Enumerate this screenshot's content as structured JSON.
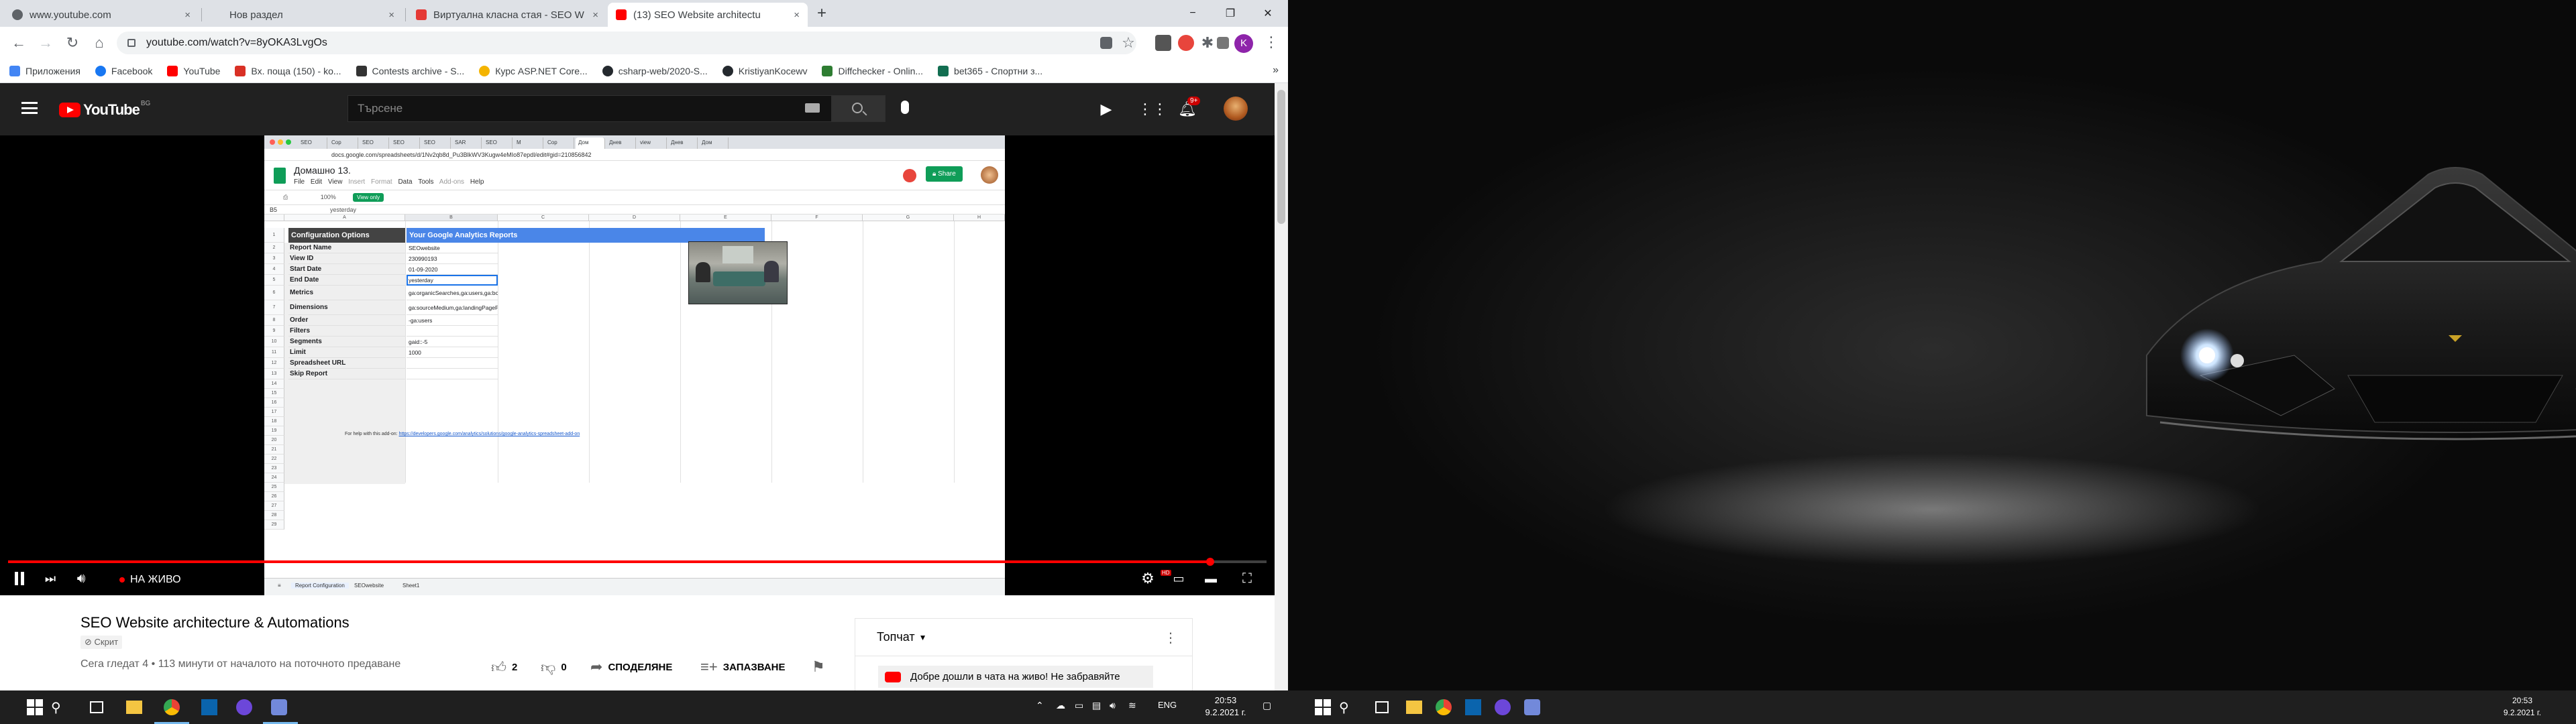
{
  "browser": {
    "tabs": [
      {
        "label": "www.youtube.com",
        "favicon_color": "#5f6368",
        "active": false
      },
      {
        "label": "Нов раздел",
        "favicon_color": "#dee1e6",
        "active": false
      },
      {
        "label": "Виртуална класна стая - SEO W",
        "favicon_color": "#e53935",
        "active": false
      },
      {
        "label": "(13) SEO Website architectu",
        "favicon_color": "#ff0000",
        "active": true
      }
    ],
    "close_glyph": "×",
    "new_tab_glyph": "+",
    "window_controls": {
      "minimize": "−",
      "maximize": "❐",
      "close": "✕"
    },
    "url": "youtube.com/watch?v=8yOKA3LvgOs",
    "profile_initial": "K"
  },
  "bookmarks": [
    {
      "label": "Приложения",
      "color": "#4285f4"
    },
    {
      "label": "Facebook",
      "color": "#1877f2"
    },
    {
      "label": "YouTube",
      "color": "#ff0000"
    },
    {
      "label": "Вх. поща (150) - ko...",
      "color": "#d93025"
    },
    {
      "label": "Contests archive - S...",
      "color": "#333333"
    },
    {
      "label": "Курс ASP.NET Core...",
      "color": "#f4b400"
    },
    {
      "label": "csharp-web/2020-S...",
      "color": "#24292e"
    },
    {
      "label": "KristiyanKocewv",
      "color": "#24292e"
    },
    {
      "label": "Diffchecker - Onlin...",
      "color": "#2e7d32"
    },
    {
      "label": "bet365 - Спортни з...",
      "color": "#126e51"
    }
  ],
  "bookmarks_more": "»",
  "youtube": {
    "logo_text": "YouTube",
    "country": "BG",
    "search_placeholder": "Търсене",
    "notification_count": "9+"
  },
  "player": {
    "live_label": "НА ЖИВО",
    "progress": 0.955,
    "spreadsheet": {
      "browser_tabs": [
        "SEO",
        "Сор",
        "SEO",
        "SEO",
        "SEO",
        "SAR",
        "SEO",
        "M",
        "Сор",
        "Дом",
        "Днев",
        "view",
        "Днев",
        "Дом"
      ],
      "url": "docs.google.com/spreadsheets/d/1Nv2qb8d_Pu3BlkWV3Kugw4eMIo87epdl/edit#gid=210856842",
      "doc_title": "Домашно 13.",
      "menu": [
        "File",
        "Edit",
        "View",
        "Insert",
        "Format",
        "Data",
        "Tools",
        "Add-ons",
        "Help"
      ],
      "share_label": "Share",
      "zoom": "100%",
      "view_only_label": "View only",
      "name_box": "B5",
      "formula_value": "yesterday",
      "columns": [
        "A",
        "B",
        "C",
        "D",
        "E",
        "F",
        "G",
        "H"
      ],
      "header_left": "Configuration Options",
      "header_right": "Your Google Analytics Reports",
      "rows": [
        {
          "num": "2",
          "label": "Report Name",
          "value": "SEOwebsite"
        },
        {
          "num": "3",
          "label": "View ID",
          "value": "230990193"
        },
        {
          "num": "4",
          "label": "Start Date",
          "value": "01-09-2020"
        },
        {
          "num": "5",
          "label": "End Date",
          "value": "yesterday"
        },
        {
          "num": "6",
          "label": "Metrics",
          "value": "ga:organicSearches,ga:users,ga:bounceRate"
        },
        {
          "num": "7",
          "label": "Dimensions",
          "value": "ga:sourceMedium,ga:landingPagePath"
        },
        {
          "num": "8",
          "label": "Order",
          "value": "-ga:users"
        },
        {
          "num": "9",
          "label": "Filters",
          "value": ""
        },
        {
          "num": "10",
          "label": "Segments",
          "value": "gaid::-5"
        },
        {
          "num": "11",
          "label": "Limit",
          "value": "1000"
        },
        {
          "num": "12",
          "label": "Spreadsheet URL",
          "value": ""
        },
        {
          "num": "13",
          "label": "Skip Report",
          "value": ""
        }
      ],
      "extra_row_numbers": [
        "14",
        "15",
        "16",
        "17",
        "18",
        "19",
        "20",
        "21",
        "22",
        "23",
        "24",
        "25",
        "26",
        "27",
        "28",
        "29"
      ],
      "help_text": "For help with this add-on:",
      "help_link": "https://developers.google.com/analytics/solutions/google-analytics-spreadsheet-add-on",
      "sheet_tabs": [
        "Report Configuration",
        "SEOwebsite",
        "Sheet1"
      ]
    }
  },
  "video": {
    "title": "SEO Website architecture & Automations",
    "channel_chip": "Скрит",
    "viewers": "Сега гледат 4 • 113 минути от началото на поточното предаване",
    "likes": "2",
    "dislikes": "0",
    "share_label": "СПОДЕЛЯНЕ",
    "save_label": "ЗАПАЗВАНЕ"
  },
  "chat": {
    "header": "Топчат",
    "message": "Добре дошли в чата на живо! Не забравяйте"
  },
  "taskbar_left": {
    "language": "ENG",
    "time": "20:53",
    "date": "9.2.2021 г."
  },
  "taskbar_right": {
    "time": "20:53",
    "date": "9.2.2021 г."
  }
}
